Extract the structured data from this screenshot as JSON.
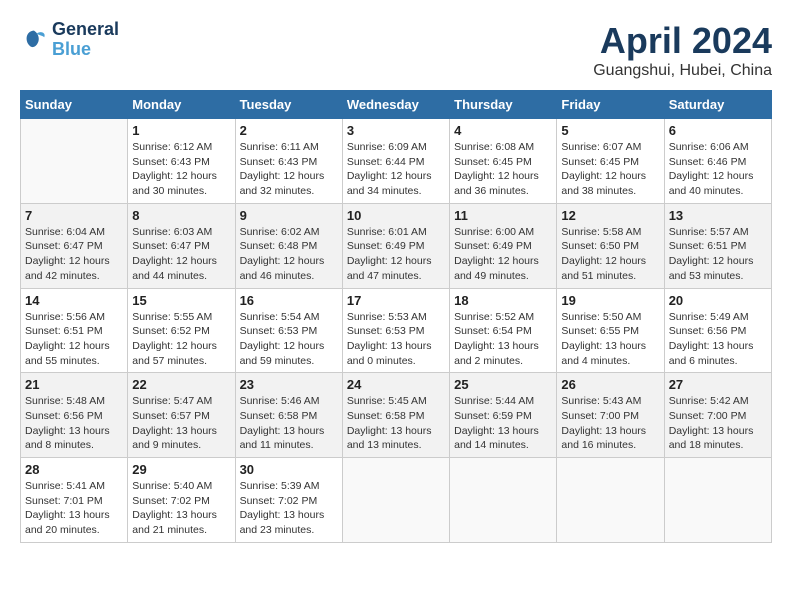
{
  "header": {
    "logo_line1": "General",
    "logo_line2": "Blue",
    "title": "April 2024",
    "subtitle": "Guangshui, Hubei, China"
  },
  "calendar": {
    "days_of_week": [
      "Sunday",
      "Monday",
      "Tuesday",
      "Wednesday",
      "Thursday",
      "Friday",
      "Saturday"
    ],
    "weeks": [
      [
        {
          "day": "",
          "info": ""
        },
        {
          "day": "1",
          "info": "Sunrise: 6:12 AM\nSunset: 6:43 PM\nDaylight: 12 hours\nand 30 minutes."
        },
        {
          "day": "2",
          "info": "Sunrise: 6:11 AM\nSunset: 6:43 PM\nDaylight: 12 hours\nand 32 minutes."
        },
        {
          "day": "3",
          "info": "Sunrise: 6:09 AM\nSunset: 6:44 PM\nDaylight: 12 hours\nand 34 minutes."
        },
        {
          "day": "4",
          "info": "Sunrise: 6:08 AM\nSunset: 6:45 PM\nDaylight: 12 hours\nand 36 minutes."
        },
        {
          "day": "5",
          "info": "Sunrise: 6:07 AM\nSunset: 6:45 PM\nDaylight: 12 hours\nand 38 minutes."
        },
        {
          "day": "6",
          "info": "Sunrise: 6:06 AM\nSunset: 6:46 PM\nDaylight: 12 hours\nand 40 minutes."
        }
      ],
      [
        {
          "day": "7",
          "info": "Sunrise: 6:04 AM\nSunset: 6:47 PM\nDaylight: 12 hours\nand 42 minutes."
        },
        {
          "day": "8",
          "info": "Sunrise: 6:03 AM\nSunset: 6:47 PM\nDaylight: 12 hours\nand 44 minutes."
        },
        {
          "day": "9",
          "info": "Sunrise: 6:02 AM\nSunset: 6:48 PM\nDaylight: 12 hours\nand 46 minutes."
        },
        {
          "day": "10",
          "info": "Sunrise: 6:01 AM\nSunset: 6:49 PM\nDaylight: 12 hours\nand 47 minutes."
        },
        {
          "day": "11",
          "info": "Sunrise: 6:00 AM\nSunset: 6:49 PM\nDaylight: 12 hours\nand 49 minutes."
        },
        {
          "day": "12",
          "info": "Sunrise: 5:58 AM\nSunset: 6:50 PM\nDaylight: 12 hours\nand 51 minutes."
        },
        {
          "day": "13",
          "info": "Sunrise: 5:57 AM\nSunset: 6:51 PM\nDaylight: 12 hours\nand 53 minutes."
        }
      ],
      [
        {
          "day": "14",
          "info": "Sunrise: 5:56 AM\nSunset: 6:51 PM\nDaylight: 12 hours\nand 55 minutes."
        },
        {
          "day": "15",
          "info": "Sunrise: 5:55 AM\nSunset: 6:52 PM\nDaylight: 12 hours\nand 57 minutes."
        },
        {
          "day": "16",
          "info": "Sunrise: 5:54 AM\nSunset: 6:53 PM\nDaylight: 12 hours\nand 59 minutes."
        },
        {
          "day": "17",
          "info": "Sunrise: 5:53 AM\nSunset: 6:53 PM\nDaylight: 13 hours\nand 0 minutes."
        },
        {
          "day": "18",
          "info": "Sunrise: 5:52 AM\nSunset: 6:54 PM\nDaylight: 13 hours\nand 2 minutes."
        },
        {
          "day": "19",
          "info": "Sunrise: 5:50 AM\nSunset: 6:55 PM\nDaylight: 13 hours\nand 4 minutes."
        },
        {
          "day": "20",
          "info": "Sunrise: 5:49 AM\nSunset: 6:56 PM\nDaylight: 13 hours\nand 6 minutes."
        }
      ],
      [
        {
          "day": "21",
          "info": "Sunrise: 5:48 AM\nSunset: 6:56 PM\nDaylight: 13 hours\nand 8 minutes."
        },
        {
          "day": "22",
          "info": "Sunrise: 5:47 AM\nSunset: 6:57 PM\nDaylight: 13 hours\nand 9 minutes."
        },
        {
          "day": "23",
          "info": "Sunrise: 5:46 AM\nSunset: 6:58 PM\nDaylight: 13 hours\nand 11 minutes."
        },
        {
          "day": "24",
          "info": "Sunrise: 5:45 AM\nSunset: 6:58 PM\nDaylight: 13 hours\nand 13 minutes."
        },
        {
          "day": "25",
          "info": "Sunrise: 5:44 AM\nSunset: 6:59 PM\nDaylight: 13 hours\nand 14 minutes."
        },
        {
          "day": "26",
          "info": "Sunrise: 5:43 AM\nSunset: 7:00 PM\nDaylight: 13 hours\nand 16 minutes."
        },
        {
          "day": "27",
          "info": "Sunrise: 5:42 AM\nSunset: 7:00 PM\nDaylight: 13 hours\nand 18 minutes."
        }
      ],
      [
        {
          "day": "28",
          "info": "Sunrise: 5:41 AM\nSunset: 7:01 PM\nDaylight: 13 hours\nand 20 minutes."
        },
        {
          "day": "29",
          "info": "Sunrise: 5:40 AM\nSunset: 7:02 PM\nDaylight: 13 hours\nand 21 minutes."
        },
        {
          "day": "30",
          "info": "Sunrise: 5:39 AM\nSunset: 7:02 PM\nDaylight: 13 hours\nand 23 minutes."
        },
        {
          "day": "",
          "info": ""
        },
        {
          "day": "",
          "info": ""
        },
        {
          "day": "",
          "info": ""
        },
        {
          "day": "",
          "info": ""
        }
      ]
    ]
  }
}
